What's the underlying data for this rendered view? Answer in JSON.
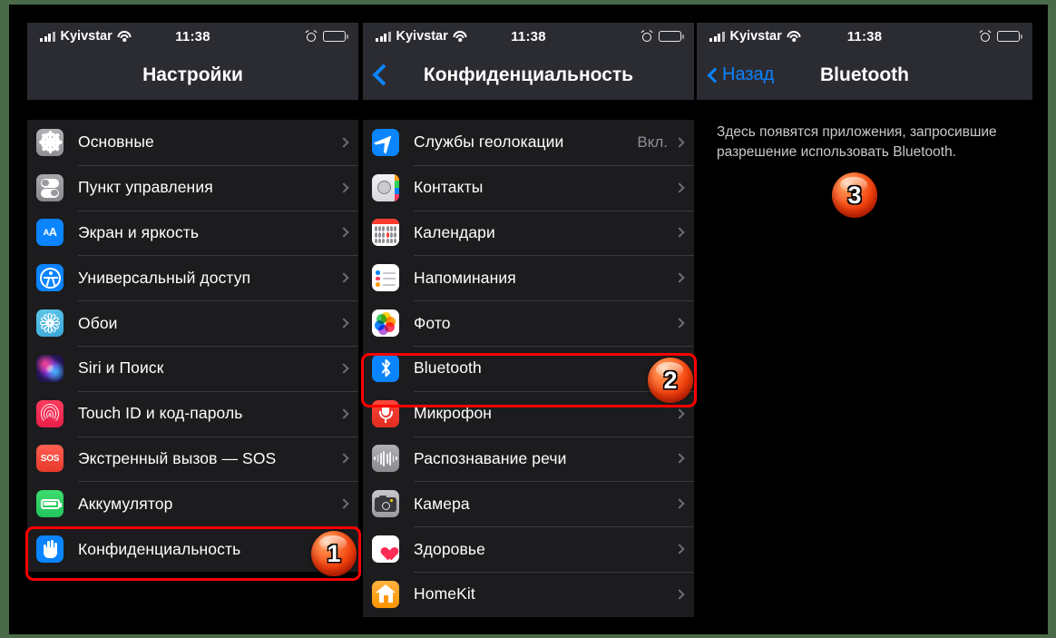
{
  "statusbar": {
    "carrier": "Kyivstar",
    "time": "11:38",
    "signal_icon": "cellular-bars-icon",
    "wifi_icon": "wifi-icon",
    "alarm_icon": "alarm-clock-icon",
    "battery_icon": "battery-icon"
  },
  "accent_color": "#0a84ff",
  "highlight_color": "#ff0000",
  "panels": [
    {
      "title": "Настройки",
      "back": null,
      "rows": [
        {
          "label": "Основные",
          "icon": "gear-icon",
          "value": ""
        },
        {
          "label": "Пункт управления",
          "icon": "control-center-icon",
          "value": ""
        },
        {
          "label": "Экран и яркость",
          "icon": "display-brightness-icon",
          "value": ""
        },
        {
          "label": "Универсальный доступ",
          "icon": "accessibility-icon",
          "value": ""
        },
        {
          "label": "Обои",
          "icon": "wallpaper-icon",
          "value": ""
        },
        {
          "label": "Siri и Поиск",
          "icon": "siri-icon",
          "value": ""
        },
        {
          "label": "Touch ID и код-пароль",
          "icon": "touch-id-icon",
          "value": ""
        },
        {
          "label": "Экстренный вызов — SOS",
          "icon": "sos-icon",
          "value": ""
        },
        {
          "label": "Аккумулятор",
          "icon": "battery-app-icon",
          "value": ""
        },
        {
          "label": "Конфиденциальность",
          "icon": "privacy-hand-icon",
          "value": ""
        }
      ]
    },
    {
      "title": "Конфиденциальность",
      "back": "",
      "rows": [
        {
          "label": "Службы геолокации",
          "icon": "location-services-icon",
          "value": "Вкл."
        },
        {
          "label": "Контакты",
          "icon": "contacts-icon",
          "value": ""
        },
        {
          "label": "Календари",
          "icon": "calendar-icon",
          "value": ""
        },
        {
          "label": "Напоминания",
          "icon": "reminders-icon",
          "value": ""
        },
        {
          "label": "Фото",
          "icon": "photos-icon",
          "value": ""
        },
        {
          "label": "Bluetooth",
          "icon": "bluetooth-icon",
          "value": ""
        },
        {
          "label": "Микрофон",
          "icon": "microphone-icon",
          "value": ""
        },
        {
          "label": "Распознавание речи",
          "icon": "speech-recognition-icon",
          "value": ""
        },
        {
          "label": "Камера",
          "icon": "camera-icon",
          "value": ""
        },
        {
          "label": "Здоровье",
          "icon": "health-icon",
          "value": ""
        },
        {
          "label": "HomeKit",
          "icon": "homekit-icon",
          "value": ""
        }
      ]
    },
    {
      "title": "Bluetooth",
      "back": "Назад",
      "empty_text": "Здесь появятся приложения, запросившие разрешение использовать Bluetooth."
    }
  ],
  "badges": [
    {
      "number": "1"
    },
    {
      "number": "2"
    },
    {
      "number": "3"
    }
  ]
}
